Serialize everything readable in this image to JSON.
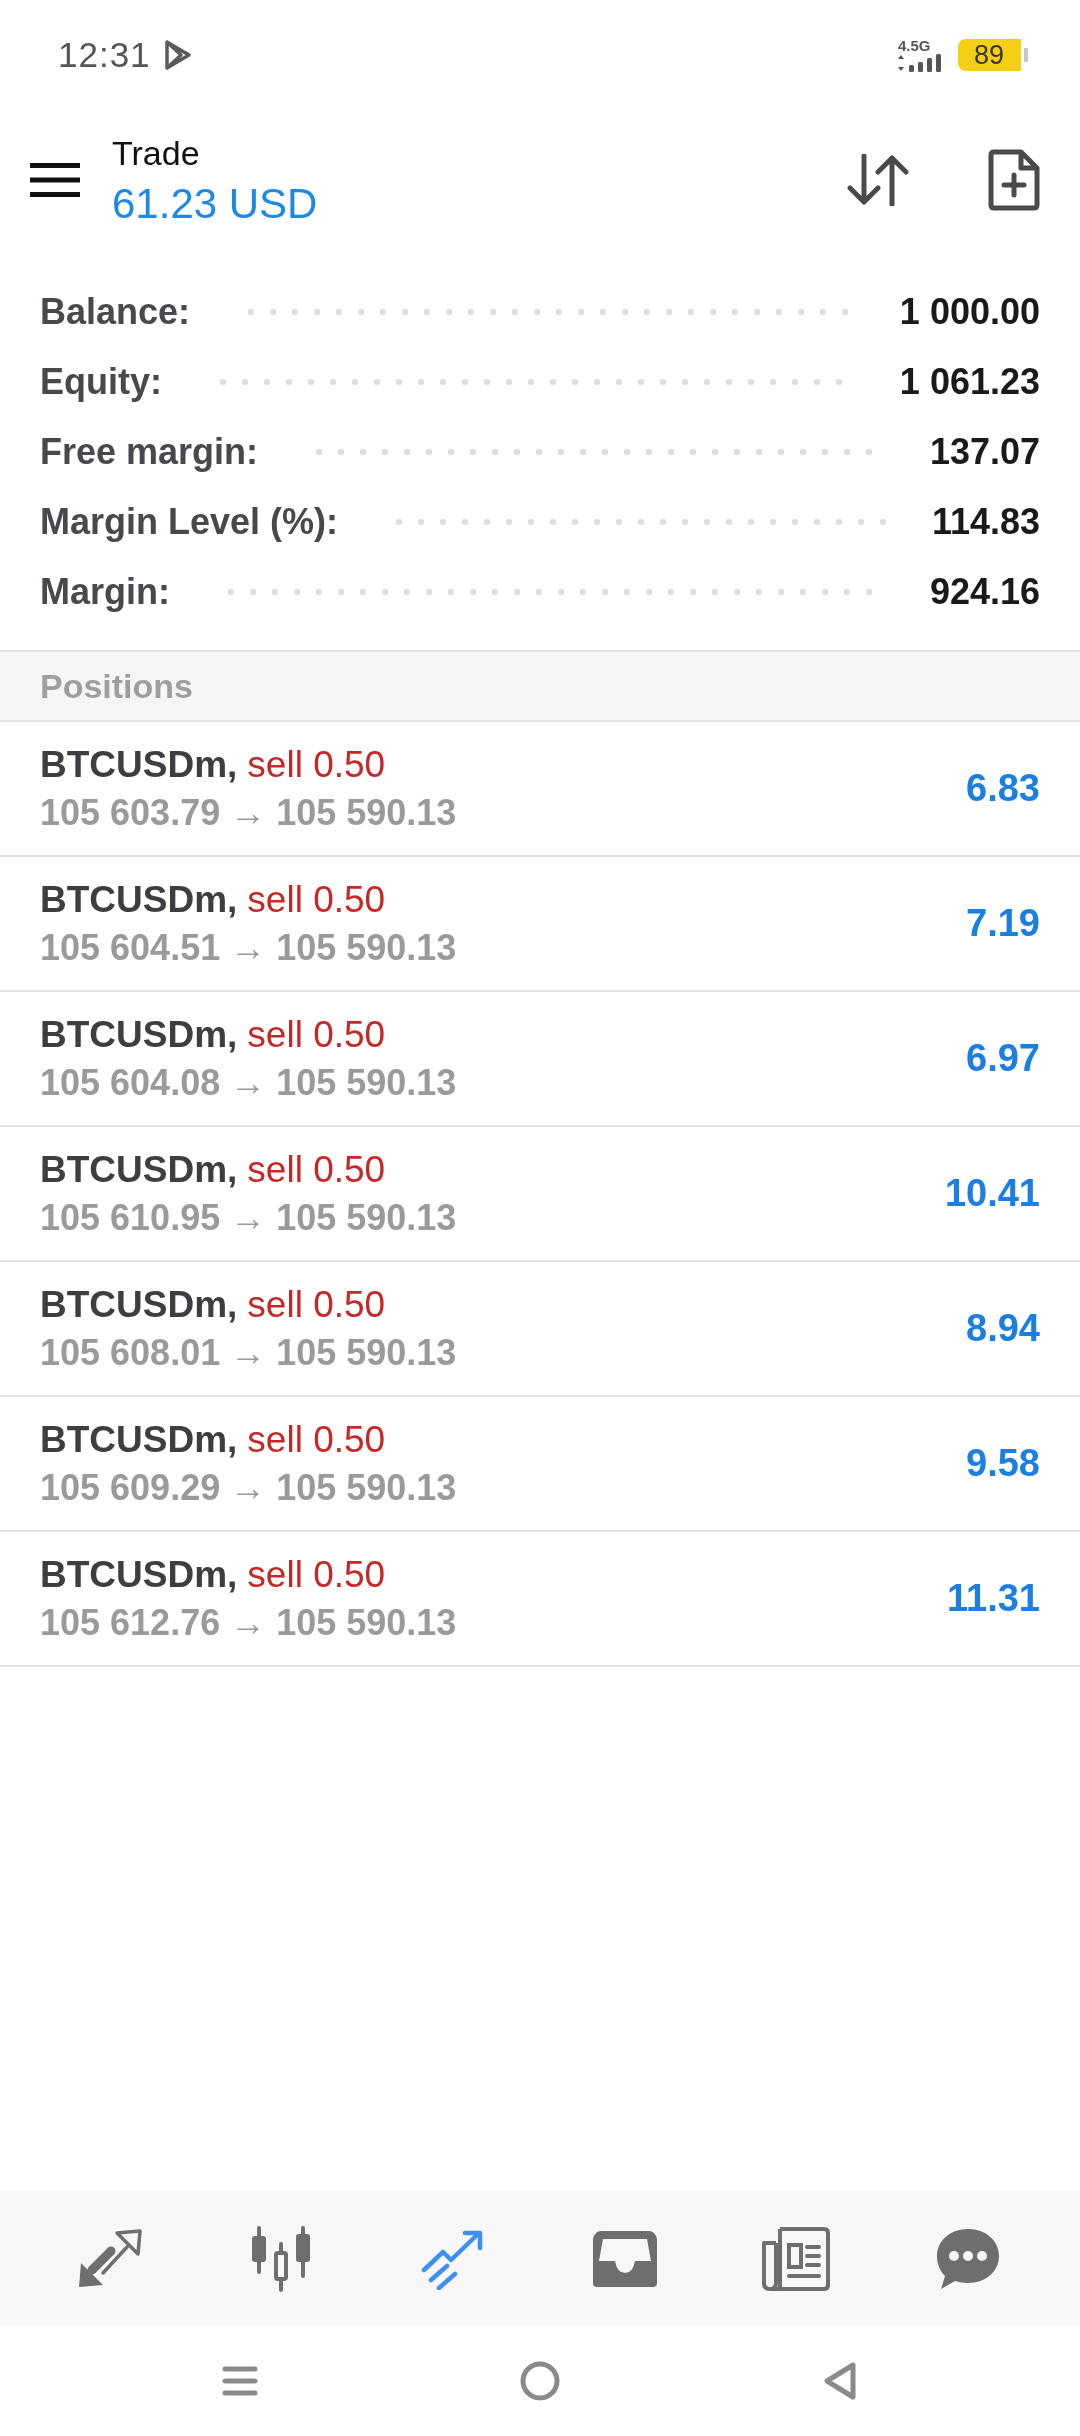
{
  "status_bar": {
    "time": "12:31",
    "network": "4.5G",
    "battery": "89"
  },
  "header": {
    "title": "Trade",
    "balance": "61.23 USD"
  },
  "account": [
    {
      "label": "Balance:",
      "value": "1 000.00"
    },
    {
      "label": "Equity:",
      "value": "1 061.23"
    },
    {
      "label": "Free margin:",
      "value": "137.07"
    },
    {
      "label": "Margin Level (%):",
      "value": "114.83"
    },
    {
      "label": "Margin:",
      "value": "924.16"
    }
  ],
  "positions": {
    "title": "Positions",
    "rows": [
      {
        "symbol": "BTCUSDm,",
        "type": "sell",
        "volume": "0.50",
        "prices": "105 603.79 → 105 590.13",
        "profit": "6.83"
      },
      {
        "symbol": "BTCUSDm,",
        "type": "sell",
        "volume": "0.50",
        "prices": "105 604.51 → 105 590.13",
        "profit": "7.19"
      },
      {
        "symbol": "BTCUSDm,",
        "type": "sell",
        "volume": "0.50",
        "prices": "105 604.08 → 105 590.13",
        "profit": "6.97"
      },
      {
        "symbol": "BTCUSDm,",
        "type": "sell",
        "volume": "0.50",
        "prices": "105 610.95 → 105 590.13",
        "profit": "10.41"
      },
      {
        "symbol": "BTCUSDm,",
        "type": "sell",
        "volume": "0.50",
        "prices": "105 608.01 → 105 590.13",
        "profit": "8.94"
      },
      {
        "symbol": "BTCUSDm,",
        "type": "sell",
        "volume": "0.50",
        "prices": "105 609.29 → 105 590.13",
        "profit": "9.58"
      },
      {
        "symbol": "BTCUSDm,",
        "type": "sell",
        "volume": "0.50",
        "prices": "105 612.76 → 105 590.13",
        "profit": "11.31"
      }
    ]
  },
  "bottom_nav": [
    {
      "selected": false
    },
    {
      "selected": false
    },
    {
      "selected": true
    },
    {
      "selected": false
    },
    {
      "selected": false
    },
    {
      "selected": false
    }
  ]
}
